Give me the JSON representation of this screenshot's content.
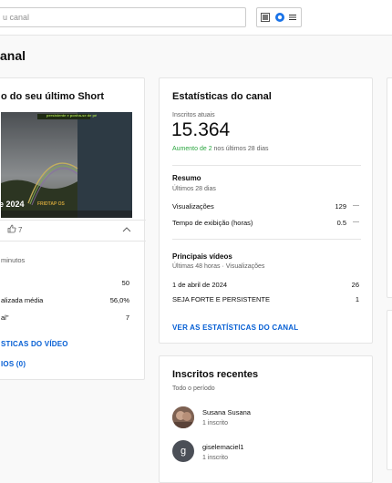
{
  "search": {
    "placeholder": "u canal"
  },
  "header_icons": [
    "create-icon",
    "channel-avatar-icon",
    "menu-icon"
  ],
  "page": {
    "title": "anal"
  },
  "short_card": {
    "title": "o do seu último Short",
    "thumb_top_text": "persistente e ponha-se de pé",
    "thumb_overlay_text": "e 2024",
    "thumb_side_text": "FRIDTAP OS",
    "likes": "7",
    "time_label": "minutos",
    "rows": [
      {
        "label": "",
        "value": "50"
      },
      {
        "label": "alizada média",
        "value": "56,0%"
      },
      {
        "label": "al\"",
        "value": "7"
      }
    ],
    "link_stats": "STICAS DO VÍDEO",
    "link_comments": "IOS (0)"
  },
  "stats_card": {
    "title": "Estatísticas do canal",
    "subs_label": "Inscritos atuais",
    "subs_count": "15.364",
    "subs_change_prefix": "Aumento de 2",
    "subs_change_suffix": " nos últimos 28 dias",
    "summary_title": "Resumo",
    "summary_period": "Últimos 28 dias",
    "summary_rows": [
      {
        "label": "Visualizações",
        "value": "129",
        "trend": "—"
      },
      {
        "label": "Tempo de exibição (horas)",
        "value": "0.5",
        "trend": "—"
      }
    ],
    "top_title": "Principais vídeos",
    "top_period": "Últimas 48 horas · Visualizações",
    "top_rows": [
      {
        "label": "1 de abril de 2024",
        "value": "26"
      },
      {
        "label": "SEJA FORTE E PERSISTENTE",
        "value": "1"
      }
    ],
    "link": "VER AS ESTATÍSTICAS DO CANAL"
  },
  "subs_card": {
    "title": "Inscritos recentes",
    "period": "Todo o período",
    "items": [
      {
        "name": "Susana Susana",
        "count": "1 inscrito",
        "initial": ""
      },
      {
        "name": "giselemaciel1",
        "count": "1 inscrito",
        "initial": "g"
      }
    ]
  },
  "colors": {
    "accent_blue": "#065fd4",
    "positive_green": "#2ba640",
    "avatar_bg": "#4b4f57"
  }
}
